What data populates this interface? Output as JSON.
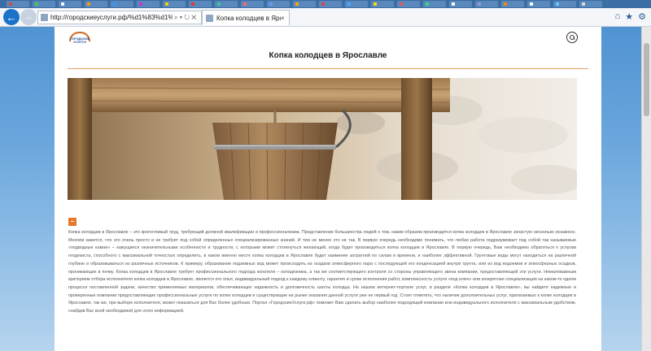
{
  "browser": {
    "address_url": "http://городскиеуслуги.рф/%d1%83%d1%81%d0%bc%",
    "address_controls": "⌕ ▾ ↻ ✕",
    "tab_title": "Копка колодцев в Ярославле",
    "tab_close": "×"
  },
  "page": {
    "logo_text": "ГОРОДСКИЕ УСЛУГИ",
    "title": "Копка колодцев в Ярославле",
    "collapse_label": "−",
    "article_text": "Копка колодцев в Ярославле – это кропотливый труд, требующий должной квалификации и профессионализма. Представление большинства людей о том, каким образом производится копка колодцев в Ярославле зачастую несколько искажено. Многим кажется, что это очень просто и не требует под собой определенных специализированных знаний. И тем не менее это не так. В первую очередь необходимо понимать, что любая работа подразумевает под собой так называемые «подводные камни» – кажущиеся незначительными особенности и трудности, с которыми может столкнуться желающий, когда будет производиться копка колодцев в Ярославле. В первую очередь, Вам необходимо обратиться к услугам геодезиста, способного с максимальной точностью определить, в каком именно месте копка колодцев в Ярославле будет наименее затратной по силам и времени, и наиболее эффективной. Грунтовые воды могут находиться на различной глубине и образовываться из различных источников. К примеру, образование подземных вод может происходить из осадков атмосферного пара с последующей его конденсацией внутри грунта, или из вод водоемов и атмосферных осадков, проникающих в почву. Копка колодцев в Ярославле требует профессионального подхода копателя – колодезника, а так же соответствующего контроля со стороны управляющего звена компании, предоставляющей эти услуги. Немаловажным критерием отбора исполнителя копка колодцев в Ярославле, является его опыт, индивидуальный подход к каждому клиенту, гарантия и сроки исполнения работ, комплексность услуги «под ключ» или конкретная специализация на каком-то одном процессе поставленной задачи, качество применяемых материалов, обеспечивающих надежность и долговечность шахты колодца. На нашем интернет-портале услуг, в разделе «Копка колодцев в Ярославле», вы найдете надежные и проверенные компании предоставляющие профессиональные услуги по копке колодцев и существующие на рынке оказания данной услуги уже не первый год. Стоит отметить, что наличие дополнительных услуг, прилагаемых к копке колодцев в Ярославле, так же, при выборе исполнителя, может показаться для Вас более удобным. Портал «ГородскиеУслуги.рф» поможет Вам сделать выбор наиболее подходящей компании или индивидуального исполнителя с максимальным удобством, снабдив Вас всей необходимой для этого информацией."
  },
  "icons": {
    "back": "arrow-left-icon",
    "forward": "arrow-right-icon",
    "search": "search-icon",
    "home": "home-icon",
    "favorites": "star-icon",
    "settings": "gear-icon"
  },
  "colors": {
    "accent": "#e9772b",
    "browser_blue": "#1a73c9",
    "rule": "#e0a060"
  }
}
